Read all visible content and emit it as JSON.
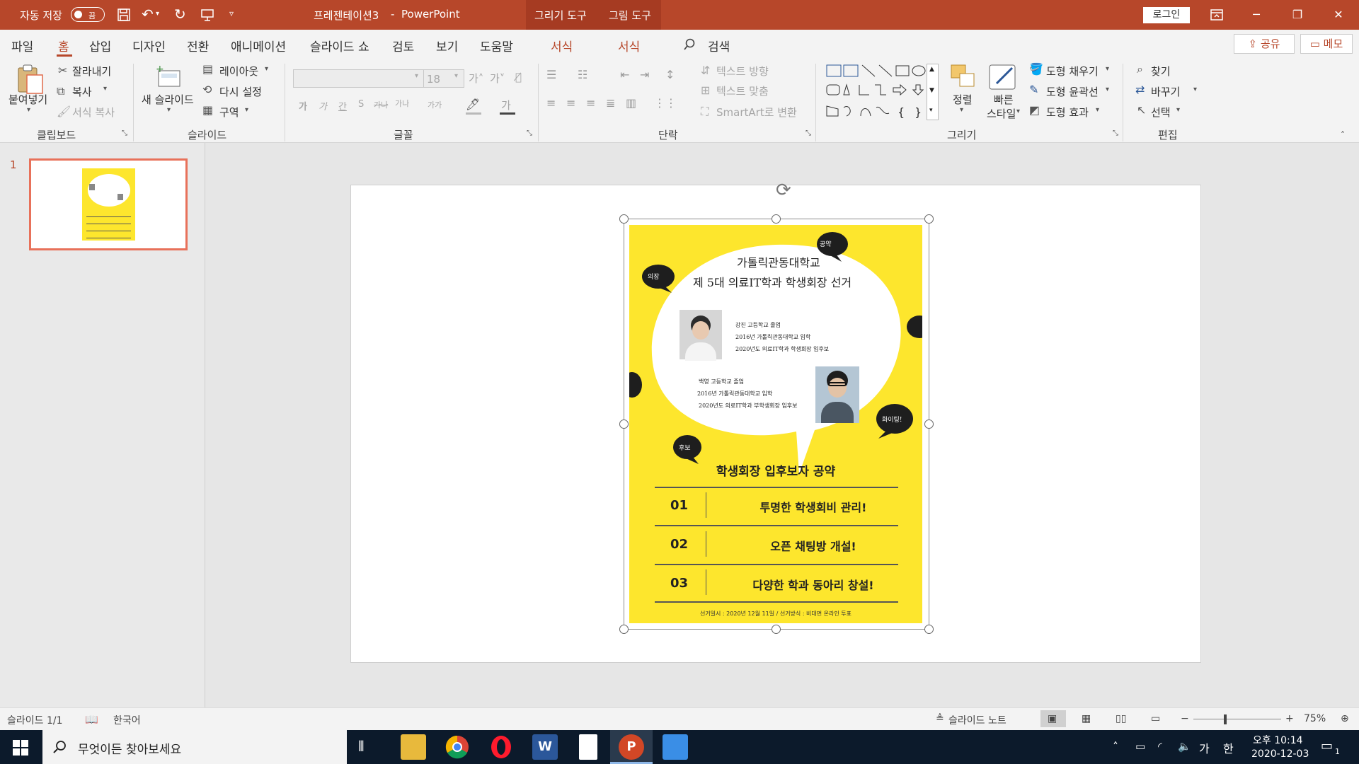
{
  "titlebar": {
    "autosave_label": "자동 저장",
    "autosave_state": "끔",
    "doc_title": "프레젠테이션3",
    "separator": "-",
    "app_name": "PowerPoint",
    "context_tab_1": "그리기 도구",
    "context_tab_2": "그림 도구",
    "login": "로그인",
    "minimize": "─",
    "restore": "❐",
    "close": "✕"
  },
  "tabs": {
    "items": [
      "파일",
      "홈",
      "삽입",
      "디자인",
      "전환",
      "애니메이션",
      "슬라이드 쇼",
      "검토",
      "보기",
      "도움말",
      "서식",
      "서식"
    ],
    "search": "검색",
    "share": "공유",
    "memo": "메모"
  },
  "ribbon": {
    "clipboard": {
      "paste": "붙여넣기",
      "cut": "잘라내기",
      "copy": "복사",
      "format_painter": "서식 복사",
      "group": "클립보드"
    },
    "slides": {
      "new_slide": "새 슬라이드",
      "layout": "레이아웃",
      "reset": "다시 설정",
      "section": "구역",
      "group": "슬라이드"
    },
    "font": {
      "font_size": "18",
      "group": "글꼴",
      "bold": "가",
      "italic": "가",
      "underline": "간",
      "shadow": "S",
      "strike": "가나",
      "spacing": "가나",
      "case": "가가"
    },
    "paragraph": {
      "text_direction": "텍스트 방향",
      "align_text": "텍스트 맞춤",
      "smartart": "SmartArt로 변환",
      "group": "단락"
    },
    "drawing": {
      "arrange": "정렬",
      "quick_styles_1": "빠른",
      "quick_styles_2": "스타일",
      "fill": "도형 채우기",
      "outline": "도형 윤곽선",
      "effects": "도형 효과",
      "group": "그리기"
    },
    "editing": {
      "find": "찾기",
      "replace": "바꾸기",
      "select": "선택",
      "group": "편집"
    }
  },
  "thumbnails": {
    "slide_number": "1"
  },
  "poster": {
    "title_line1": "가톨릭관동대학교",
    "title_line2": "제 5대 의료IT학과 학생회장 선거",
    "bubble_tl": "의장",
    "bubble_top": "공약",
    "bubble_right": "화이팅!",
    "bubble_bottom": "후보",
    "candidate1": [
      "강진 고등학교 졸업",
      "2016년 가톨릭관동대학교 입학",
      "2020년도 의료IT학과 학생회장 입후보"
    ],
    "candidate2": [
      "백영 고등학교 졸업",
      "2016년 가톨릭관동대학교 입학",
      "2020년도 의료IT학과 부학생회장 입후보"
    ],
    "pledge_title": "학생회장 입후보자 공약",
    "pledges": [
      {
        "num": "01",
        "text": "투명한 학생회비 관리!"
      },
      {
        "num": "02",
        "text": "오픈 채팅방 개설!"
      },
      {
        "num": "03",
        "text": "다양한 학과 동아리 창설!"
      }
    ],
    "footer": "선거일시 : 2020년 12월 11일 / 선거방식 : 비대면 온라인 투표"
  },
  "statusbar": {
    "slide_info": "슬라이드 1/1",
    "language": "한국어",
    "notes": "슬라이드 노트",
    "zoom": "75%",
    "zoom_minus": "−",
    "zoom_plus": "+"
  },
  "taskbar": {
    "search_placeholder": "무엇이든 찾아보세요",
    "time": "오후 10:14",
    "date": "2020-12-03",
    "ime_1": "가",
    "ime_2": "한",
    "notification_count": "1"
  },
  "colors": {
    "accent": "#b7472a",
    "poster_yellow": "#fde62d",
    "taskbar": "#0c1a2b"
  }
}
